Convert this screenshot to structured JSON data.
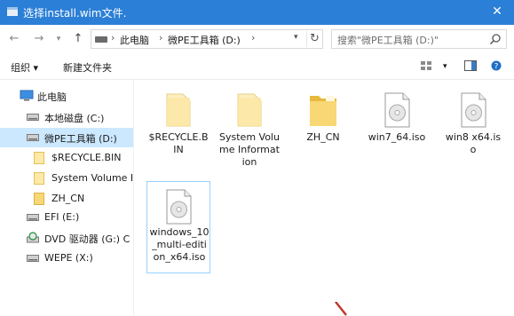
{
  "window": {
    "title": "选择install.wim文件."
  },
  "address": {
    "crumbs": [
      "此电脑",
      "微PE工具箱 (D:)"
    ],
    "search_placeholder": "搜索\"微PE工具箱 (D:)\""
  },
  "toolbar": {
    "organize": "组织 ▾",
    "new_folder": "新建文件夹"
  },
  "nav": {
    "items": [
      {
        "label": "此电脑",
        "icon": "computer-icon"
      },
      {
        "label": "本地磁盘 (C:)",
        "icon": "drive-icon"
      },
      {
        "label": "微PE工具箱 (D:)",
        "icon": "drive-icon",
        "selected": true
      },
      {
        "label": "$RECYCLE.BIN",
        "icon": "folder-icon"
      },
      {
        "label": "System Volume I",
        "icon": "folder-icon"
      },
      {
        "label": "ZH_CN",
        "icon": "folder-icon"
      },
      {
        "label": "EFI (E:)",
        "icon": "drive-icon"
      },
      {
        "label": "DVD 驱动器 (G:) C",
        "icon": "dvd-drive-icon"
      },
      {
        "label": "WEPE (X:)",
        "icon": "drive-icon"
      }
    ]
  },
  "files": [
    {
      "name": "$RECYCLE.BIN",
      "type": "folder"
    },
    {
      "name": "System Volume Information",
      "type": "folder"
    },
    {
      "name": "ZH_CN",
      "type": "folder"
    },
    {
      "name": "win7_64.iso",
      "type": "iso"
    },
    {
      "name": "win8 x64.iso",
      "type": "iso"
    },
    {
      "name": "windows_10_multi-edition_x64.iso",
      "type": "iso",
      "selected": true
    }
  ],
  "colors": {
    "titlebar": "#2b7fd6",
    "selection": "#cce8ff",
    "folder": "#f8d775"
  }
}
